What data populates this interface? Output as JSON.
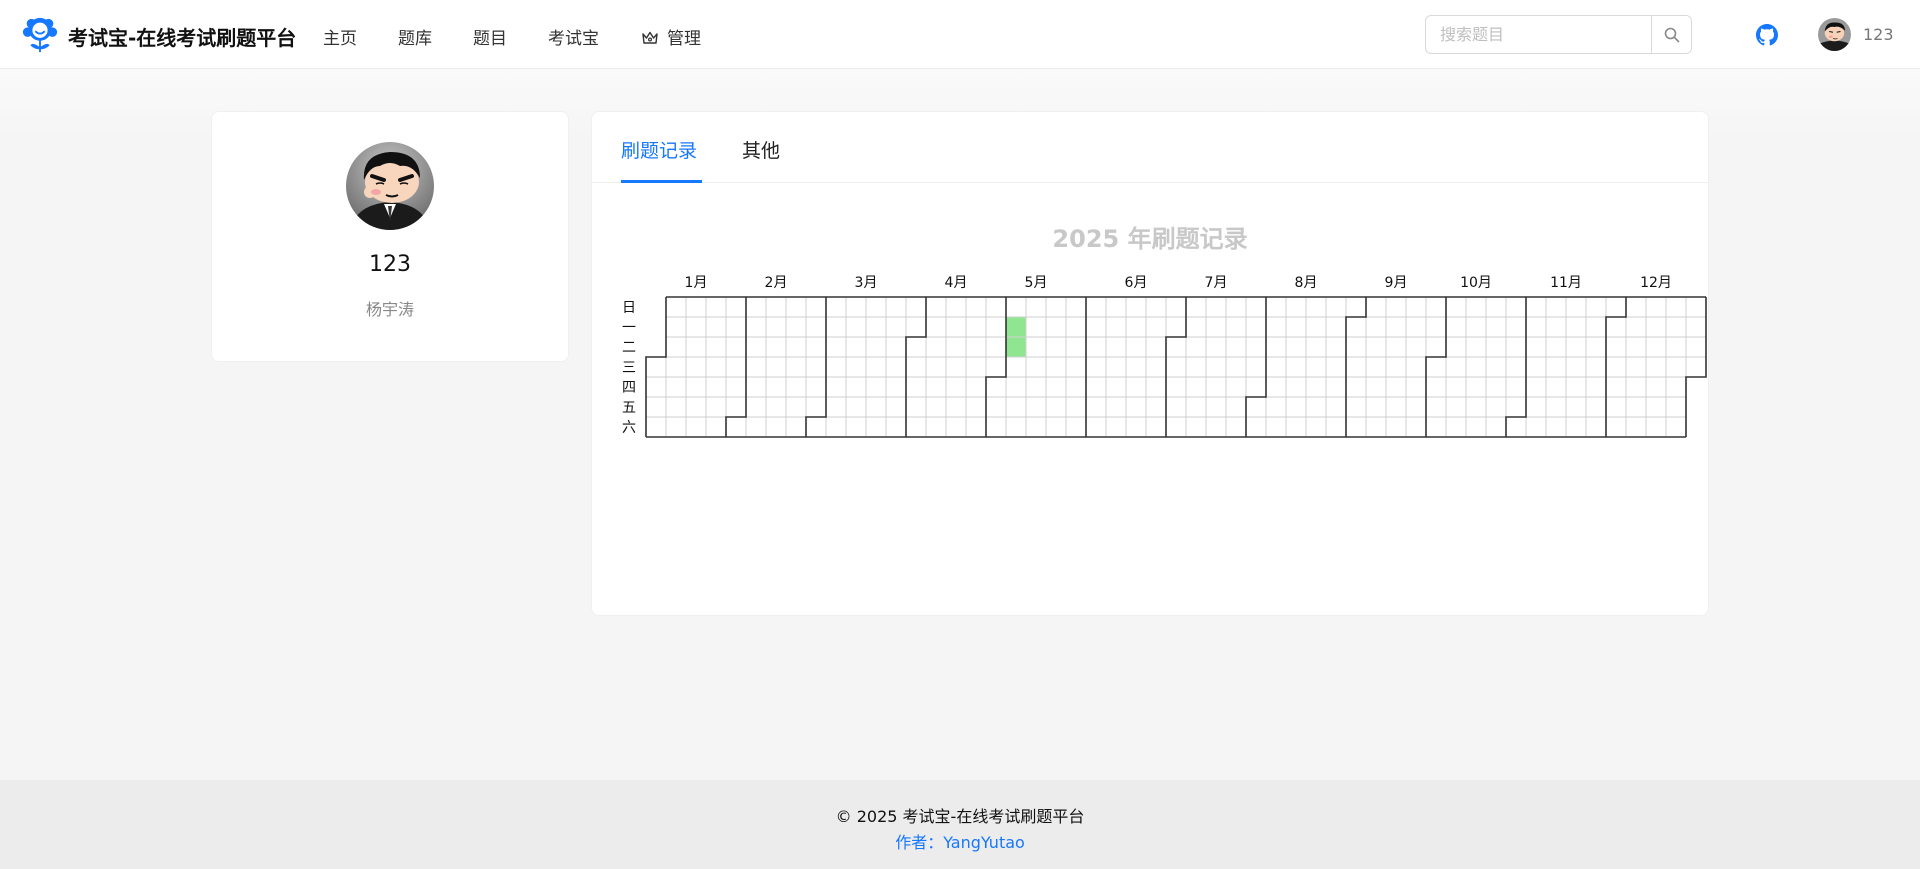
{
  "header": {
    "brand_title": "考试宝-在线考试刷题平台",
    "nav": [
      {
        "label": "主页"
      },
      {
        "label": "题库"
      },
      {
        "label": "题目"
      },
      {
        "label": "考试宝"
      },
      {
        "label": "管理",
        "icon": "crown-icon"
      }
    ],
    "search": {
      "placeholder": "搜索题目",
      "value": ""
    },
    "user_name": "123",
    "colors": {
      "accent": "#1677ff",
      "github": "#1677ff"
    }
  },
  "profile": {
    "name": "123",
    "subtitle": "杨宇涛"
  },
  "tabs": [
    {
      "label": "刷题记录",
      "active": true
    },
    {
      "label": "其他",
      "active": false
    }
  ],
  "heatmap": {
    "title": "2025 年刷题记录",
    "year": 2025,
    "month_labels": [
      "1月",
      "2月",
      "3月",
      "4月",
      "5月",
      "6月",
      "7月",
      "8月",
      "9月",
      "10月",
      "11月",
      "12月"
    ],
    "weekday_labels": [
      "日",
      "一",
      "二",
      "三",
      "四",
      "五",
      "六"
    ],
    "active_dates": [
      "2025-05-05",
      "2025-05-06"
    ],
    "active_color": "#90e690"
  },
  "footer": {
    "copyright": "© 2025 考试宝-在线考试刷题平台",
    "author": "作者：YangYutao"
  }
}
